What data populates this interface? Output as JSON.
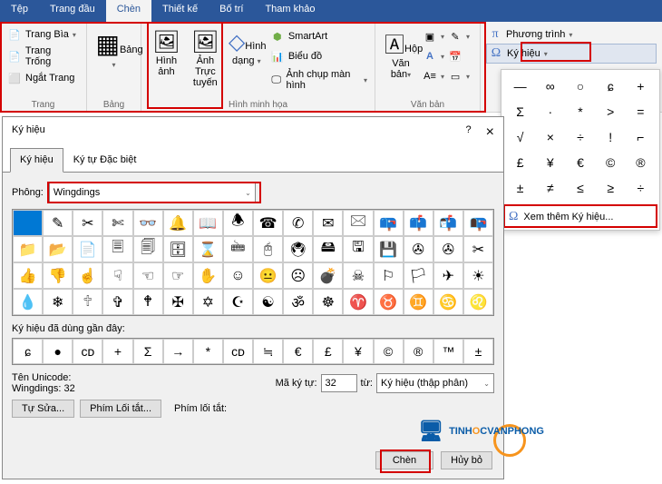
{
  "ribbon": {
    "tabs": [
      "Tệp",
      "Trang đầu",
      "Chèn",
      "Thiết kế",
      "Bố trí",
      "Tham khảo"
    ],
    "active": 2
  },
  "groups": {
    "pages": {
      "label": "Trang",
      "items": [
        "Trang Bìa",
        "Trang Trống",
        "Ngắt Trang"
      ]
    },
    "tables": {
      "label": "Bảng",
      "btn": "Bảng"
    },
    "illus": {
      "label": "Hình minh họa",
      "pic": "Hình ảnh",
      "online": "Ảnh Trực tuyến",
      "shapes": "Hình dạng",
      "smart": "SmartArt",
      "chart": "Biểu đồ",
      "screenshot": "Ảnh chụp màn hình"
    },
    "text": {
      "label": "Văn bản",
      "textbox": "Hộp Văn bản"
    },
    "symbols": {
      "equation": "Phương trình",
      "symbol": "Ký hiệu"
    }
  },
  "panel": {
    "grid": [
      "—",
      "∞",
      "○",
      "ɕ",
      "+",
      "Σ",
      "·",
      "*",
      ">",
      "=",
      "√",
      "×",
      "÷",
      "!",
      "⌐",
      "£",
      "¥",
      "€",
      "©",
      "®",
      "±",
      "≠",
      "≤",
      "≥",
      "÷"
    ],
    "more": "Xem thêm Ký hiệu..."
  },
  "dialog": {
    "title": "Ký hiệu",
    "help": "?",
    "close": "×",
    "tabs": [
      "Ký hiệu",
      "Ký tự Đặc biệt"
    ],
    "activeTab": 0,
    "fontLabel": "Phông:",
    "fontValue": "Wingdings",
    "grid": [
      "",
      "✎",
      "✂",
      "✄",
      "👓",
      "🔔",
      "📖",
      "🕭",
      "☎",
      "✆",
      "✉",
      "🖂",
      "📪",
      "📫",
      "📬",
      "📭",
      "📁",
      "📂",
      "📄",
      "🗏",
      "🗐",
      "🗄",
      "⌛",
      "🖮",
      "🖰",
      "🖲",
      "🖴",
      "🖫",
      "💾",
      "✇",
      "✇",
      "✂",
      "👍",
      "👎",
      "☝",
      "☟",
      "☜",
      "☞",
      "✋",
      "☺",
      "😐",
      "☹",
      "💣",
      "☠",
      "⚐",
      "🏳",
      "✈",
      "☀",
      "💧",
      "❄",
      "🕆",
      "✞",
      "🕈",
      "✠",
      "✡",
      "☪",
      "☯",
      "ॐ",
      "☸",
      "♈",
      "♉",
      "♊",
      "♋",
      "♌"
    ],
    "recentLabel": "Ký hiệu đã dùng gần đây:",
    "recent": [
      "ɕ",
      "●",
      "ᴄᴅ",
      "+",
      "Σ",
      "→",
      "*",
      "ᴄᴅ",
      "≒",
      "€",
      "£",
      "¥",
      "©",
      "®",
      "™",
      "±"
    ],
    "unicodeLabel": "Tên Unicode:",
    "unicodeValue": "Wingdings: 32",
    "codeLabel": "Mã ký tự:",
    "codeValue": "32",
    "fromLabel": "từ:",
    "fromValue": "Ký hiệu (thập phân)",
    "autocorrect": "Tự Sửa...",
    "shortcutBtn": "Phím Lối tắt...",
    "shortcutLabel": "Phím lối tắt:",
    "insert": "Chèn",
    "cancel": "Hủy bỏ"
  },
  "brand": {
    "t1": "TINH",
    "o": "O",
    "t2": "CVANPHONG"
  }
}
